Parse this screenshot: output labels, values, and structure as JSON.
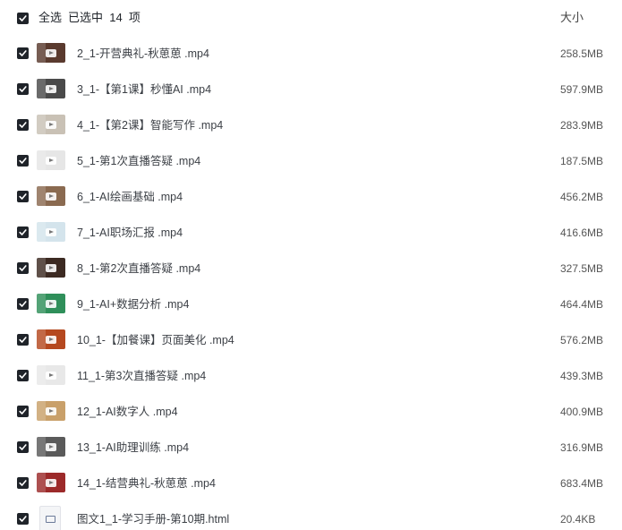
{
  "header": {
    "select_all_label": "全选",
    "selected_info": "已选中  14  项",
    "size_column_label": "大小"
  },
  "files": [
    {
      "name": "2_1-开营典礼-秋葸葸 .mp4",
      "size": "258.5MB",
      "thumb": "video",
      "thumb_color": "#5a3a2e"
    },
    {
      "name": "3_1-【第1课】秒懂AI .mp4",
      "size": "597.9MB",
      "thumb": "video",
      "thumb_color": "#4a4a4a"
    },
    {
      "name": "4_1-【第2课】智能写作 .mp4",
      "size": "283.9MB",
      "thumb": "video",
      "thumb_color": "#c9c1b5"
    },
    {
      "name": "5_1-第1次直播答疑 .mp4",
      "size": "187.5MB",
      "thumb": "video",
      "thumb_color": "#e6e6e6"
    },
    {
      "name": "6_1-AI绘画基础 .mp4",
      "size": "456.2MB",
      "thumb": "video",
      "thumb_color": "#8a6a50"
    },
    {
      "name": "7_1-AI职场汇报 .mp4",
      "size": "416.6MB",
      "thumb": "video",
      "thumb_color": "#d4e4ec"
    },
    {
      "name": "8_1-第2次直播答疑 .mp4",
      "size": "327.5MB",
      "thumb": "video",
      "thumb_color": "#3c2a22"
    },
    {
      "name": "9_1-AI+数据分析 .mp4",
      "size": "464.4MB",
      "thumb": "video",
      "thumb_color": "#2f8f5a"
    },
    {
      "name": "10_1-【加餐课】页面美化 .mp4",
      "size": "576.2MB",
      "thumb": "video",
      "thumb_color": "#b5481f"
    },
    {
      "name": "11_1-第3次直播答疑 .mp4",
      "size": "439.3MB",
      "thumb": "video",
      "thumb_color": "#e8e8e8"
    },
    {
      "name": "12_1-AI数字人 .mp4",
      "size": "400.9MB",
      "thumb": "video",
      "thumb_color": "#c9a06a"
    },
    {
      "name": "13_1-AI助理训练 .mp4",
      "size": "316.9MB",
      "thumb": "video",
      "thumb_color": "#5a5a5a"
    },
    {
      "name": "14_1-结营典礼-秋葸葸 .mp4",
      "size": "683.4MB",
      "thumb": "video",
      "thumb_color": "#9c2a2a"
    },
    {
      "name": "图文1_1-学习手册-第10期.html",
      "size": "20.4KB",
      "thumb": "html-file-icon",
      "thumb_color": "#f4f5f7"
    }
  ],
  "colors": {
    "checkbox": "#1f2329",
    "text": "#3b3f45",
    "size_text": "#555555"
  }
}
